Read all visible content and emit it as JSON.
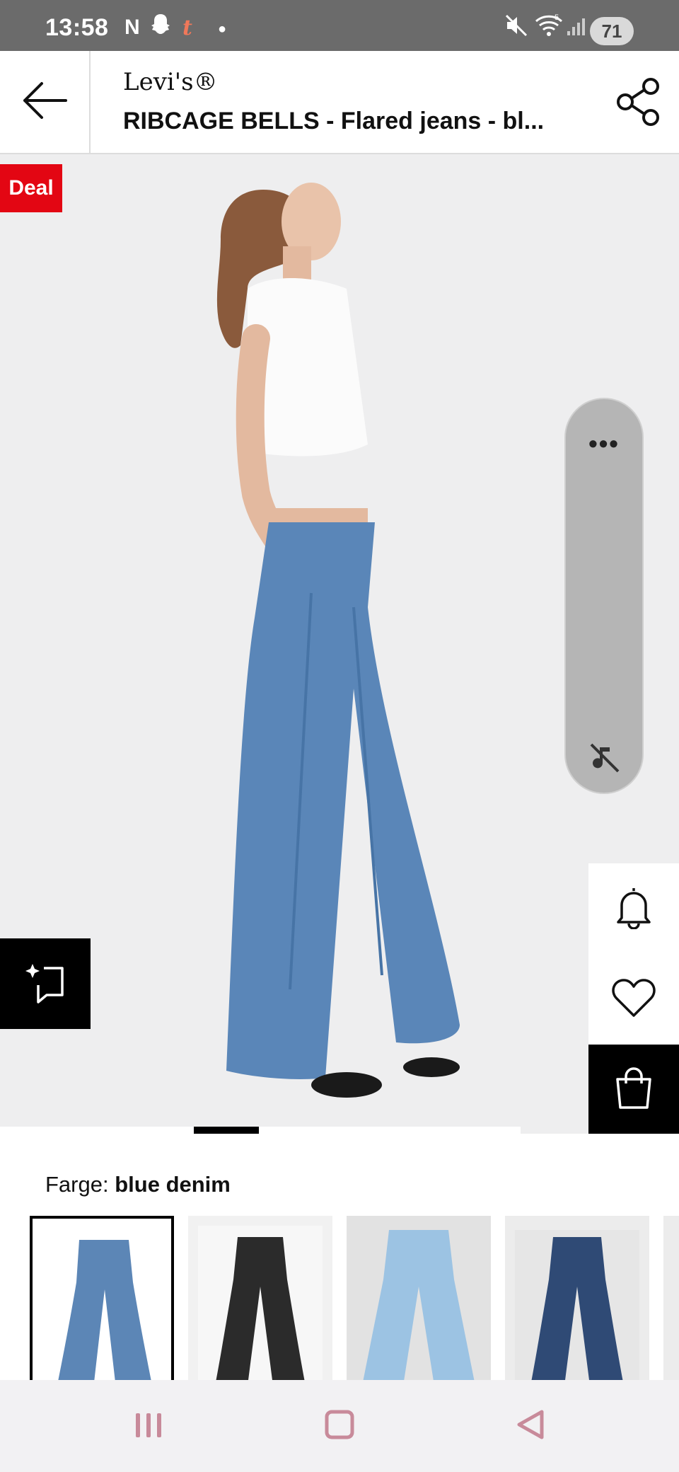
{
  "status_bar": {
    "time": "13:58",
    "notification_icons": [
      "netflix-icon",
      "snapchat-icon",
      "tumblr-icon",
      "dot-icon"
    ],
    "battery_level": "71"
  },
  "header": {
    "brand": "Levi's®",
    "title": "RIBCAGE BELLS - Flared jeans - bl..."
  },
  "product_image": {
    "badge": "Deal",
    "gallery_position": "2 of 8"
  },
  "colour": {
    "label": "Farge:",
    "value": "blue denim",
    "swatches": [
      {
        "name": "blue denim",
        "selected": true,
        "color": "#5c86b6"
      },
      {
        "name": "black",
        "selected": false,
        "color": "#2b2b2b"
      },
      {
        "name": "light blue",
        "selected": false,
        "color": "#9cc3e3"
      },
      {
        "name": "dark blue",
        "selected": false,
        "color": "#2f4a75"
      }
    ]
  },
  "colors": {
    "deal_red": "#e30613",
    "status_bar": "#6b6b6b",
    "image_bg": "#eeeeef",
    "nav_icon": "#c88a9a"
  }
}
